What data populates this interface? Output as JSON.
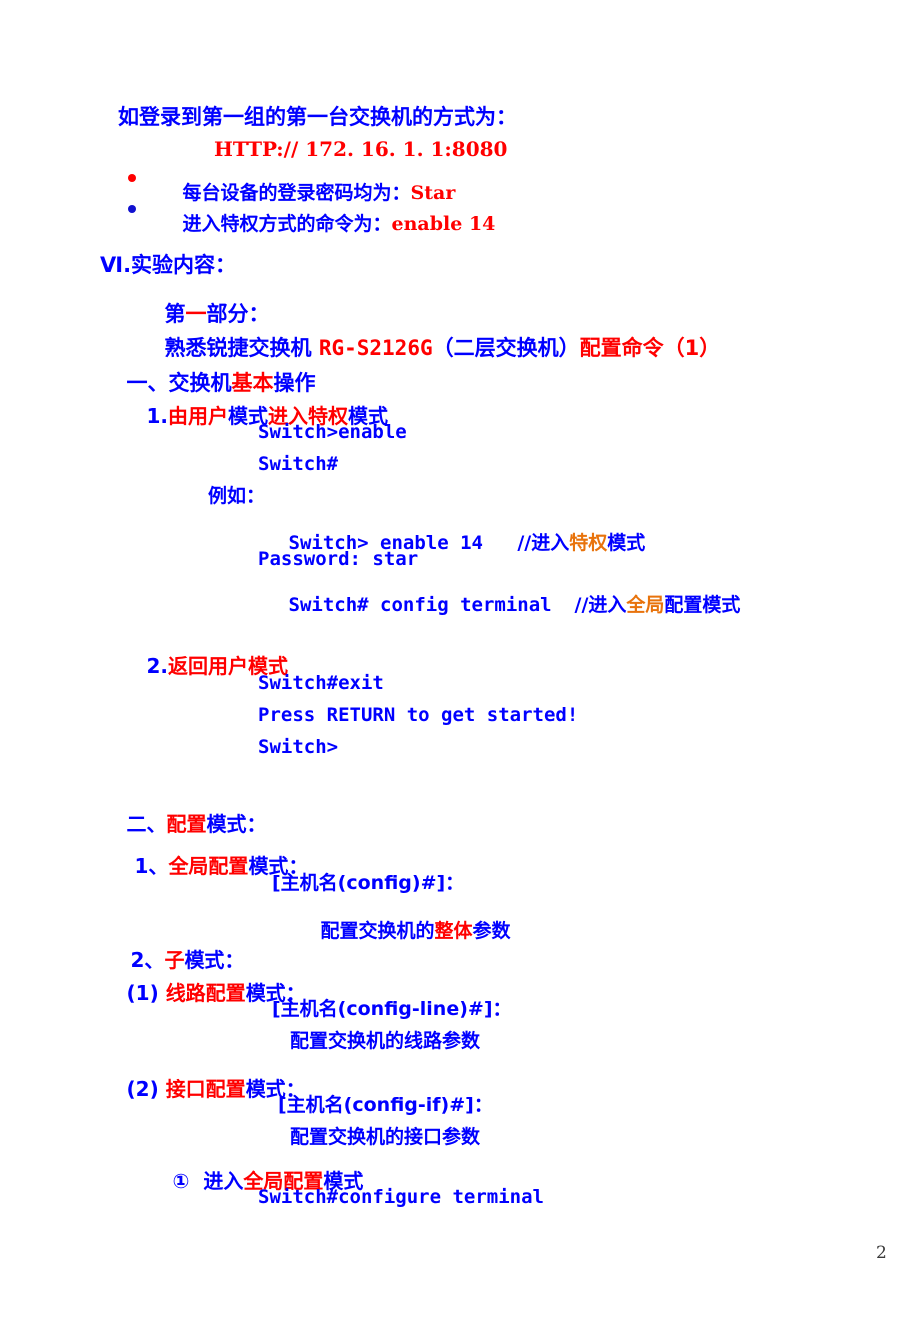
{
  "document": {
    "page_number": "2",
    "colors": {
      "blue": "#0000ff",
      "red": "#ff0000",
      "orange": "#e8730c",
      "page_number_color": "#3a3a3a"
    }
  },
  "login_section": {
    "intro_line": "如登录到第一组的第一台交换机的方式为：",
    "url_line": "HTTP:// 172. 16. 1. 1:8080",
    "bullets": [
      {
        "marker_color": "red",
        "label": "每台设备的登录密码均为：",
        "value": "Star"
      },
      {
        "marker_color": "blue",
        "label": "进入特权方式的命令为：",
        "value": "enable 14"
      }
    ]
  },
  "section_vi": {
    "heading": "Ⅵ.实验内容：",
    "part_prefix": "第",
    "part_number": "一",
    "part_suffix": "部分：",
    "title_seg1": "熟悉锐捷交换机 ",
    "title_seg2": "RG-S2126G",
    "title_seg3": "（二层交换机）",
    "title_seg4": "配置命令（1）"
  },
  "section_one": {
    "heading_seg1": "一、交换机",
    "heading_seg2": "基本",
    "heading_seg3": "操作",
    "item1": {
      "num": "1.",
      "seg1": "由用户",
      "seg2": "模式",
      "seg3": "进入特权",
      "seg4": "模式",
      "cmd1": "Switch>enable",
      "cmd2": "Switch#",
      "example_label": "例如：",
      "cmd3": "Switch> enable 14",
      "cmd3_comment_pre": "//进入",
      "cmd3_comment_hl": "特权",
      "cmd3_comment_post": "模式",
      "cmd4": "Password: star",
      "cmd5": "Switch# config terminal",
      "cmd5_comment_pre": "//进入",
      "cmd5_comment_hl": "全局",
      "cmd5_comment_post": "配置模式"
    },
    "item2": {
      "num": "2.",
      "label": "返回用户模式",
      "cmd1": "Switch#exit",
      "cmd2": "Press RETURN to get started!",
      "cmd3": "Switch>"
    }
  },
  "section_two": {
    "heading_seg1": "二、",
    "heading_seg2": "配置",
    "heading_seg3": "模式：",
    "sub1": {
      "num": "1、",
      "hl": "全局配置",
      "tail": "模式：",
      "prompt": "[主机名(config)#]：",
      "desc_pre": "配置交换机的",
      "desc_hl": "整体",
      "desc_post": "参数"
    },
    "sub2": {
      "num": "2、",
      "hl": "子",
      "tail": "模式：",
      "items": [
        {
          "num": "(1)",
          "hl": "线路配置",
          "tail": "模式：",
          "prompt": "[主机名(config-line)#]：",
          "desc": "配置交换机的线路参数"
        },
        {
          "num": "(2)",
          "hl": "接口配置",
          "tail": "模式：",
          "prompt": "[主机名(config-if)#]：",
          "desc": "配置交换机的接口参数"
        }
      ],
      "step": {
        "marker": "①",
        "pre": "进入",
        "hl": "全局配置",
        "post": "模式",
        "cmd": "Switch#configure terminal"
      }
    }
  }
}
